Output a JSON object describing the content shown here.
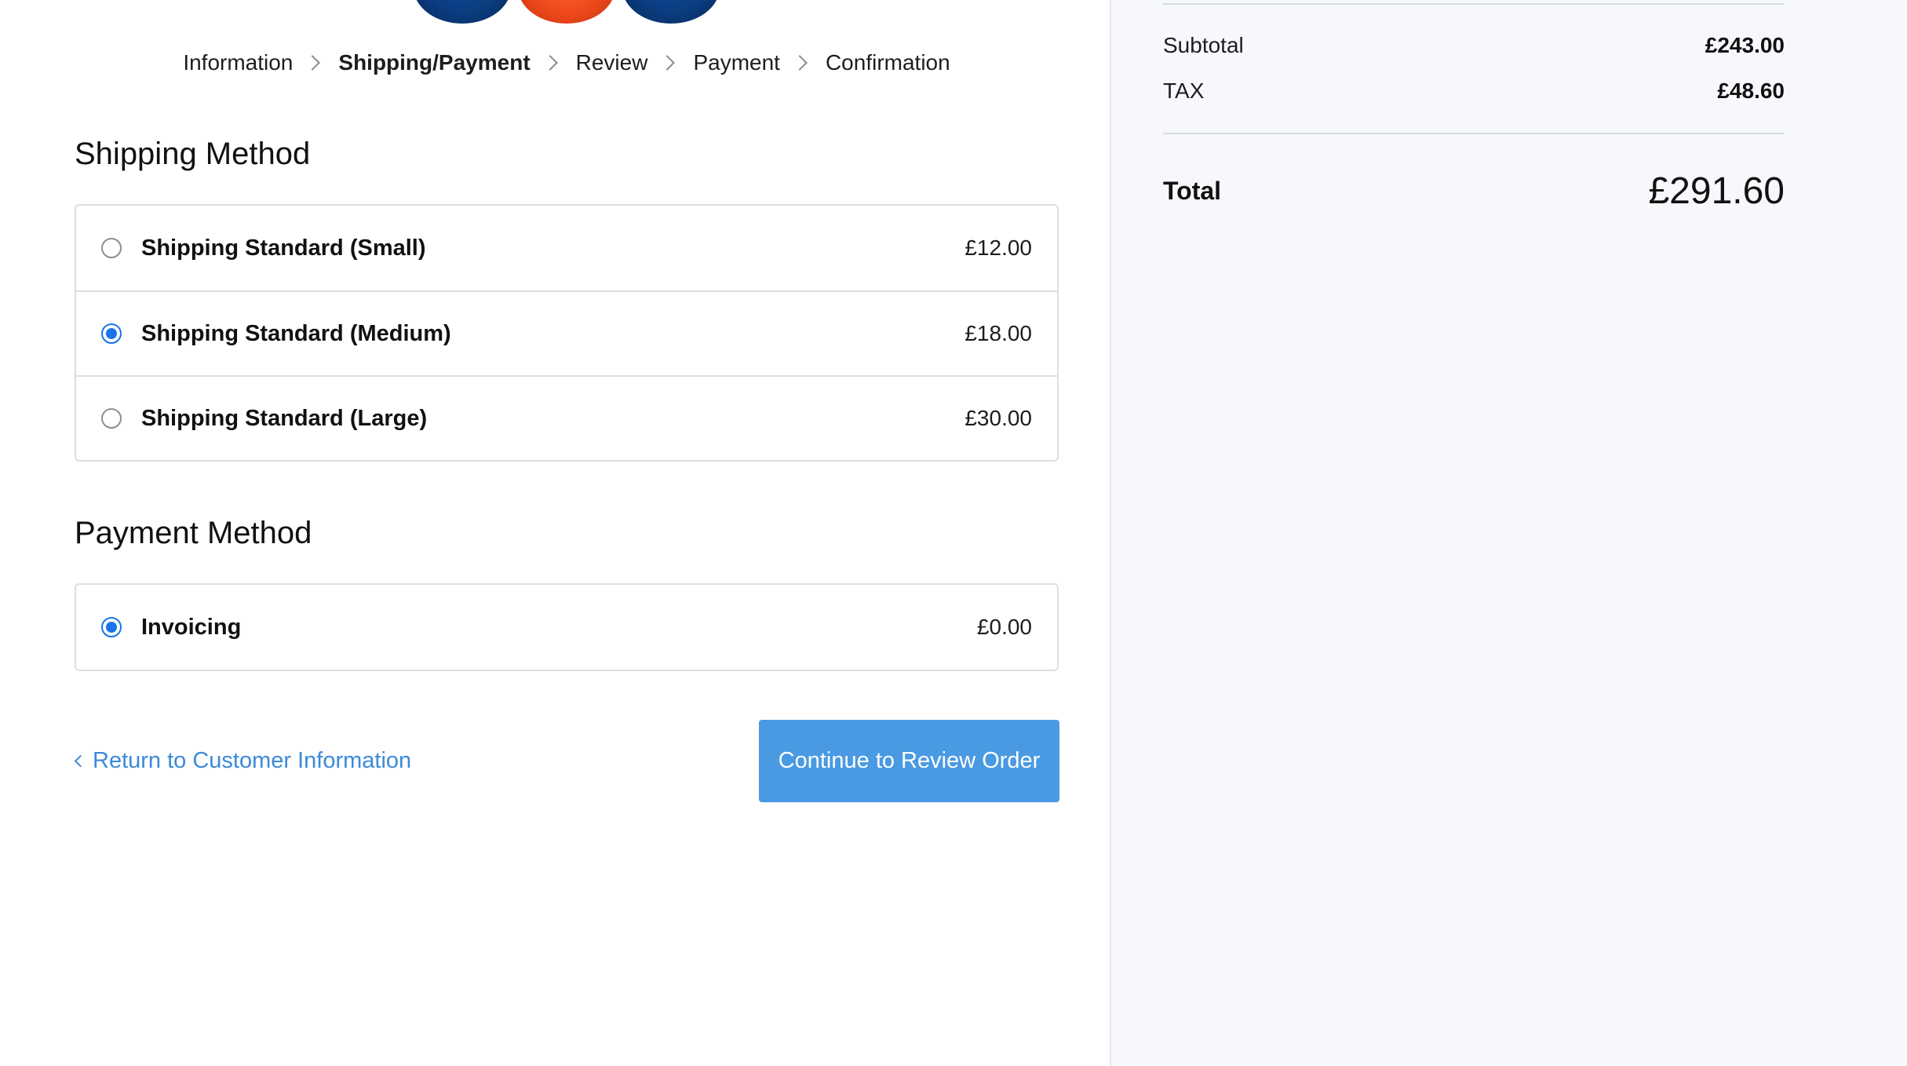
{
  "breadcrumb": {
    "steps": [
      {
        "label": "Information"
      },
      {
        "label": "Shipping/Payment"
      },
      {
        "label": "Review"
      },
      {
        "label": "Payment"
      },
      {
        "label": "Confirmation"
      }
    ],
    "active_step": "Shipping/Payment"
  },
  "shipping": {
    "title": "Shipping Method",
    "options": [
      {
        "label": "Shipping Standard (Small)",
        "price": "£12.00",
        "selected": false
      },
      {
        "label": "Shipping Standard (Medium)",
        "price": "£18.00",
        "selected": true
      },
      {
        "label": "Shipping Standard (Large)",
        "price": "£30.00",
        "selected": false
      }
    ]
  },
  "payment": {
    "title": "Payment Method",
    "options": [
      {
        "label": "Invoicing",
        "price": "£0.00",
        "selected": true
      }
    ]
  },
  "actions": {
    "back_label": "Return to Customer Information",
    "continue_label": "Continue to Review Order"
  },
  "summary": {
    "subtotal_label": "Subtotal",
    "subtotal_value": "£243.00",
    "tax_label": "TAX",
    "tax_value": "£48.60",
    "total_label": "Total",
    "total_value": "£291.60"
  },
  "colors": {
    "accent": "#4a9ae3",
    "link": "#3b8ad9",
    "radio_checked": "#1a73e8",
    "summary_bg": "#f6f8fb",
    "logo_blue": "#0b3d80",
    "logo_orange": "#f04a1c"
  },
  "icons": {
    "breadcrumb_separator": "chevron-right-icon",
    "back_link": "chevron-left-icon"
  }
}
